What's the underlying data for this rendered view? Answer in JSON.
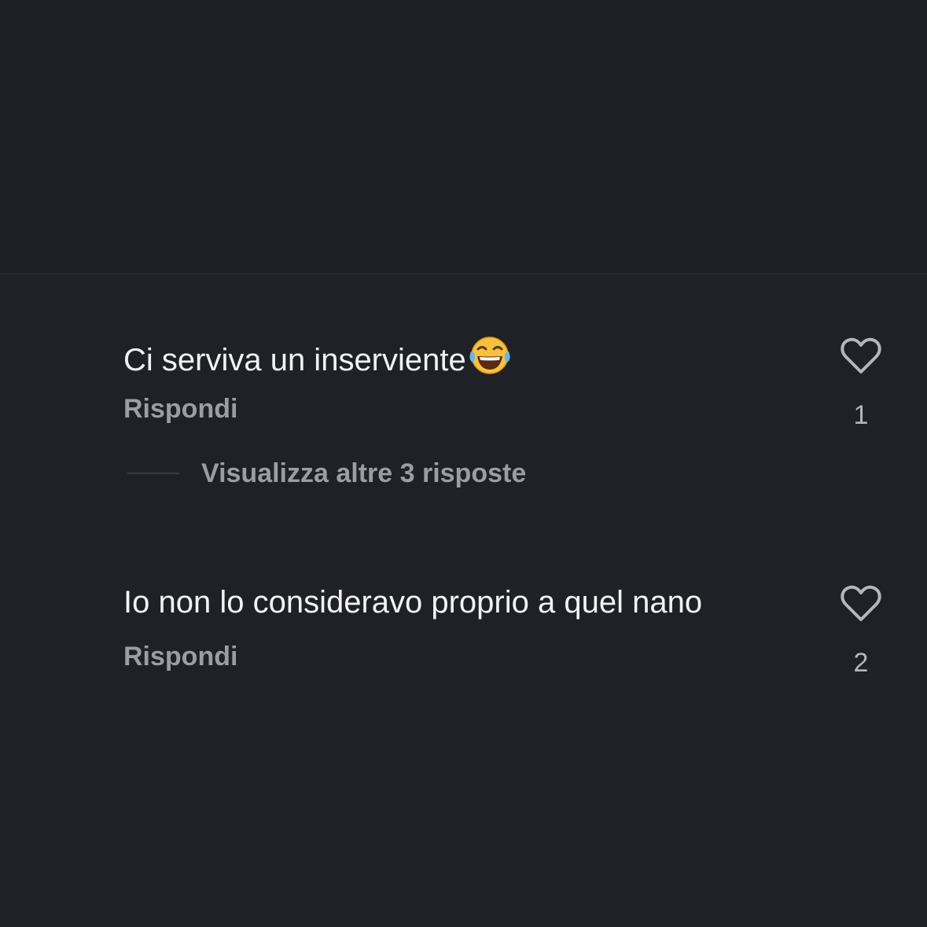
{
  "comments": [
    {
      "text": "Ci serviva un inserviente",
      "emoji": "face-with-tears-of-joy",
      "reply_label": "Rispondi",
      "like_count": "1",
      "view_replies_label": "Visualizza altre 3 risposte"
    },
    {
      "text": "Io non lo consideravo proprio a quel nano",
      "reply_label": "Rispondi",
      "like_count": "2"
    }
  ],
  "colors": {
    "background": "#202126",
    "primary_text": "#f2f2f4",
    "secondary_text": "#9b9ca5",
    "icon": "#b4b5bd"
  }
}
